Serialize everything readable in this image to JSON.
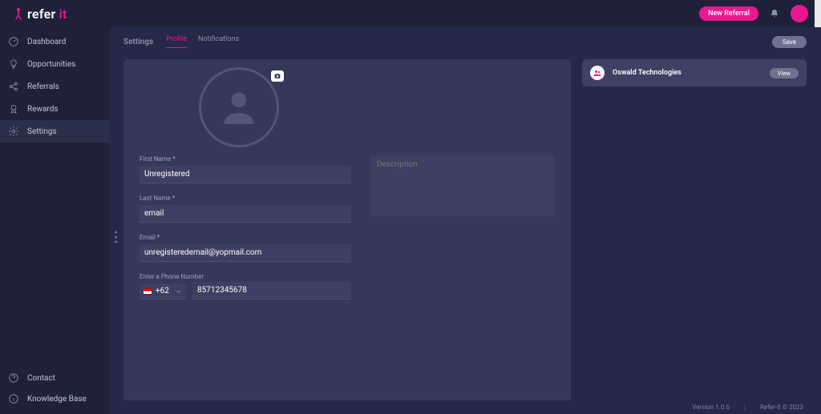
{
  "brand": {
    "part1": "refer",
    "part2": "it"
  },
  "topbar": {
    "new_referral_label": "New Referral"
  },
  "sidebar": {
    "items": [
      {
        "label": "Dashboard"
      },
      {
        "label": "Opportunities"
      },
      {
        "label": "Referrals"
      },
      {
        "label": "Rewards"
      },
      {
        "label": "Settings"
      }
    ],
    "bottom": [
      {
        "label": "Contact"
      },
      {
        "label": "Knowledge Base"
      }
    ]
  },
  "settings": {
    "title": "Settings",
    "tabs": [
      {
        "label": "Profile",
        "active": true
      },
      {
        "label": "Notifications",
        "active": false
      }
    ],
    "save_label": "Save"
  },
  "profile": {
    "first_name_label": "First Name *",
    "first_name_value": "Unregistered",
    "last_name_label": "Last Name *",
    "last_name_value": "email",
    "email_label": "Email *",
    "email_value": "unregisteredemail@yopmail.com",
    "phone_label": "Enter a Phone Number",
    "phone_code": "+62",
    "phone_value": "85712345678",
    "description_placeholder": "Description"
  },
  "org": {
    "name": "Oswald Technologies",
    "view_label": "View"
  },
  "footer": {
    "version": "Version 1.0.6",
    "separator": "|",
    "copyright": "Refer-It © 2023"
  }
}
